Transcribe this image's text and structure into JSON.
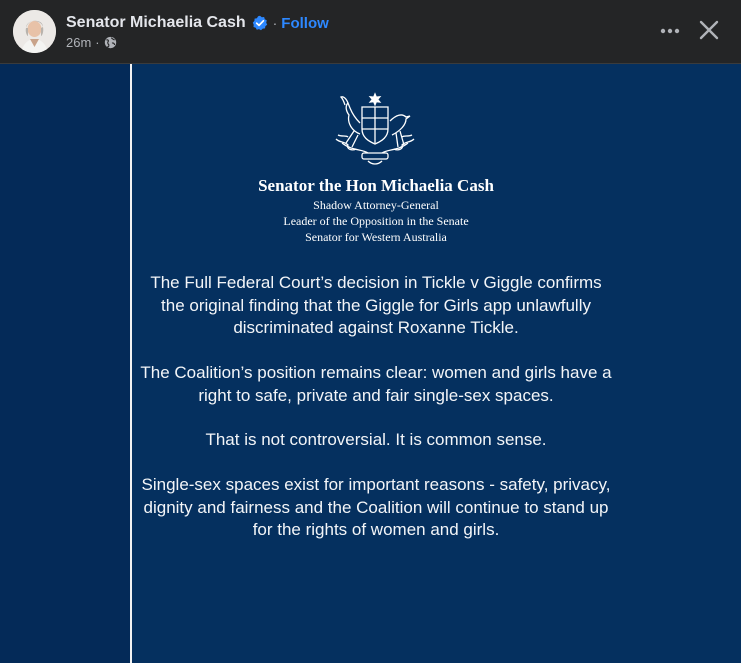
{
  "header": {
    "author_name": "Senator Michaelia Cash",
    "separator": "·",
    "follow_label": "Follow",
    "timestamp": "26m",
    "meta_separator": "·",
    "privacy_icon": "globe-icon",
    "more_icon": "more-options-icon",
    "close_icon": "close-icon",
    "verified_color": "#2d88ff"
  },
  "post": {
    "letterhead": {
      "name": "Senator the Hon Michaelia Cash",
      "line1": "Shadow Attorney-General",
      "line2": "Leader of the Opposition in the Senate",
      "line3": "Senator for Western Australia"
    },
    "paragraphs": [
      "The Full Federal Court’s decision in Tickle v Giggle confirms the original finding that the Giggle for Girls app unlawfully discriminated against Roxanne Tickle.",
      "The Coalition’s position remains clear: women and girls have a right to safe, private and fair single-sex spaces.",
      "That is not controversial. It is common sense.",
      "Single-sex spaces exist for important reasons - safety, privacy, dignity and fairness and the Coalition will continue to stand up for the rights of women and girls."
    ],
    "background_color": "#05305f"
  }
}
